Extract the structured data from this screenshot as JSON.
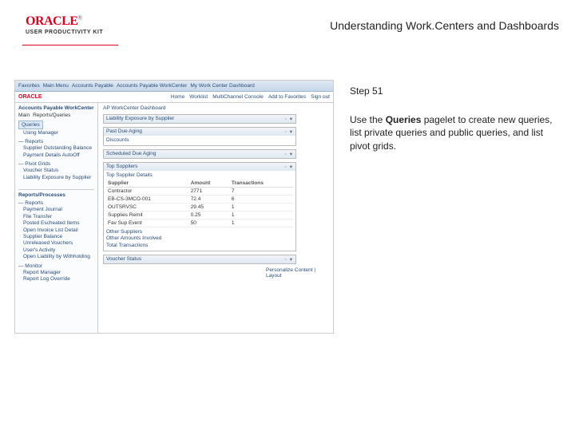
{
  "header": {
    "logo_text": "ORACLE",
    "logo_tm": "®",
    "logo_subtitle": "USER PRODUCTIVITY KIT",
    "page_title": "Understanding Work.Centers and Dashboards"
  },
  "instruction": {
    "step_label": "Step 51",
    "text_before": "Use the ",
    "bold_word": "Queries",
    "text_after": " pagelet to create new queries, list private queries and public queries, and list pivot grids."
  },
  "mock": {
    "topbar": {
      "t1": "Favorites",
      "t2": "Main Menu",
      "t3": "Accounts Payable",
      "t4": "Accounts Payable WorkCenter",
      "t5": "My Work Center Dashboard"
    },
    "orbar": {
      "logo": "ORACLE",
      "l1": "Home",
      "l2": "Worklist",
      "l3": "MultiChannel Console",
      "l4": "Add to Favorites",
      "l5": "Sign out"
    },
    "side": {
      "title": "Accounts Payable WorkCenter",
      "main_label": "Main",
      "reports_label": "Reports/Queries",
      "queries_label": "Queries",
      "q_item1": "Using Manager",
      "sec_reports": "— Reports",
      "r1": "Supplier Outstanding Balance",
      "r2": "Payment Details AutoOff",
      "sec_pivot": "— Pivot Grids",
      "p1": "Voucher Status",
      "p2": "Liability Exposure by Supplier",
      "block2_title": "Reports/Processes",
      "b2_sec1": "— Reports",
      "b2r1": "Payment Journal",
      "b2r2": "File Transfer",
      "b2r3": "Posted Escheated Items",
      "b2r4": "Open Invoice List Detail",
      "b2r5": "Supplier Balance",
      "b2r6": "Unreleased Vouchers",
      "b2r7": "User's Activity",
      "b2r8": "Open Liability by Withholding",
      "b2_sec2": "— Monitor",
      "b2m1": "Report Manager",
      "b2m2": "Report Log Override"
    },
    "main": {
      "crumb_left": "AP WorkCenter Dashboard",
      "crumb_right": "Personalize Content | Layout",
      "pagelet1_title": "Liability Exposure by Supplier",
      "pagelet2_title": "Past Due Aging",
      "pagelet2_link": "Discounts",
      "pagelet3_title": "Scheduled Due Aging",
      "pagelet4_title": "Top Suppliers",
      "pagelet5_title": "Top Supplier Details",
      "tbl_h1": "Supplier",
      "tbl_h2": "Amount",
      "tbl_h3": "Transactions",
      "rows": [
        {
          "n": "Contractor",
          "a": "2771",
          "t": "7"
        },
        {
          "n": "EB-CS-3MCO-001",
          "a": "72.4",
          "t": "6"
        },
        {
          "n": "OUTSRVSC",
          "a": "29.45",
          "t": "1"
        },
        {
          "n": "Supplies Remit",
          "a": "0.25",
          "t": "1"
        },
        {
          "n": "Fav Sup Event",
          "a": "50",
          "t": "1"
        }
      ],
      "pagelet6_title": "Other Suppliers",
      "p6a": "Other Amounts Involved",
      "p6b": "Total Transactions",
      "pagelet7_title": "Voucher Status"
    }
  }
}
